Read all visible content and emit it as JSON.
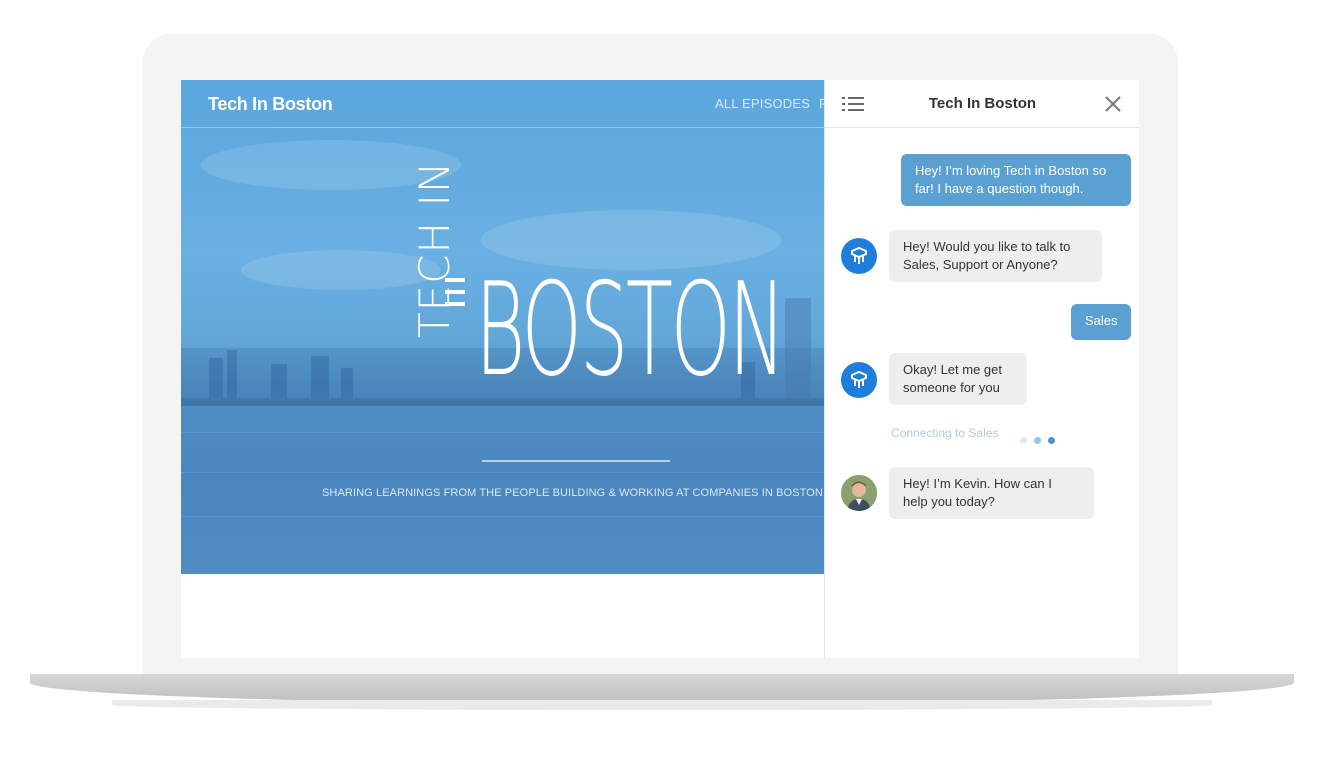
{
  "site": {
    "title": "Tech In Boston",
    "nav_label": "ALL EPISODES",
    "nav_cut": "P",
    "logo_small": "TECH IN",
    "logo_big": "BOSTON",
    "tagline": "SHARING LEARNINGS FROM THE PEOPLE BUILDING & WORKING AT COMPANIES IN BOSTON"
  },
  "chat": {
    "title": "Tech In Boston",
    "messages": [
      {
        "from": "user",
        "text": "Hey! I’m loving Tech in Boston so far! I have a question though."
      },
      {
        "from": "bot",
        "text": "Hey! Would you like to talk to Sales, Support or Anyone?"
      },
      {
        "from": "user",
        "text": "Sales"
      },
      {
        "from": "bot",
        "text": "Okay! Let me get someone for you"
      },
      {
        "from": "agent",
        "text": "Hey! I’m Kevin. How can I help you today?"
      }
    ],
    "status": "Connecting to Sales"
  },
  "colors": {
    "accent": "#5aa0d2",
    "bot_avatar": "#1f7ddb",
    "bubble_in": "#eeeeee"
  },
  "icons": [
    "list-icon",
    "close-icon",
    "bot-logo-icon",
    "user-avatar"
  ]
}
